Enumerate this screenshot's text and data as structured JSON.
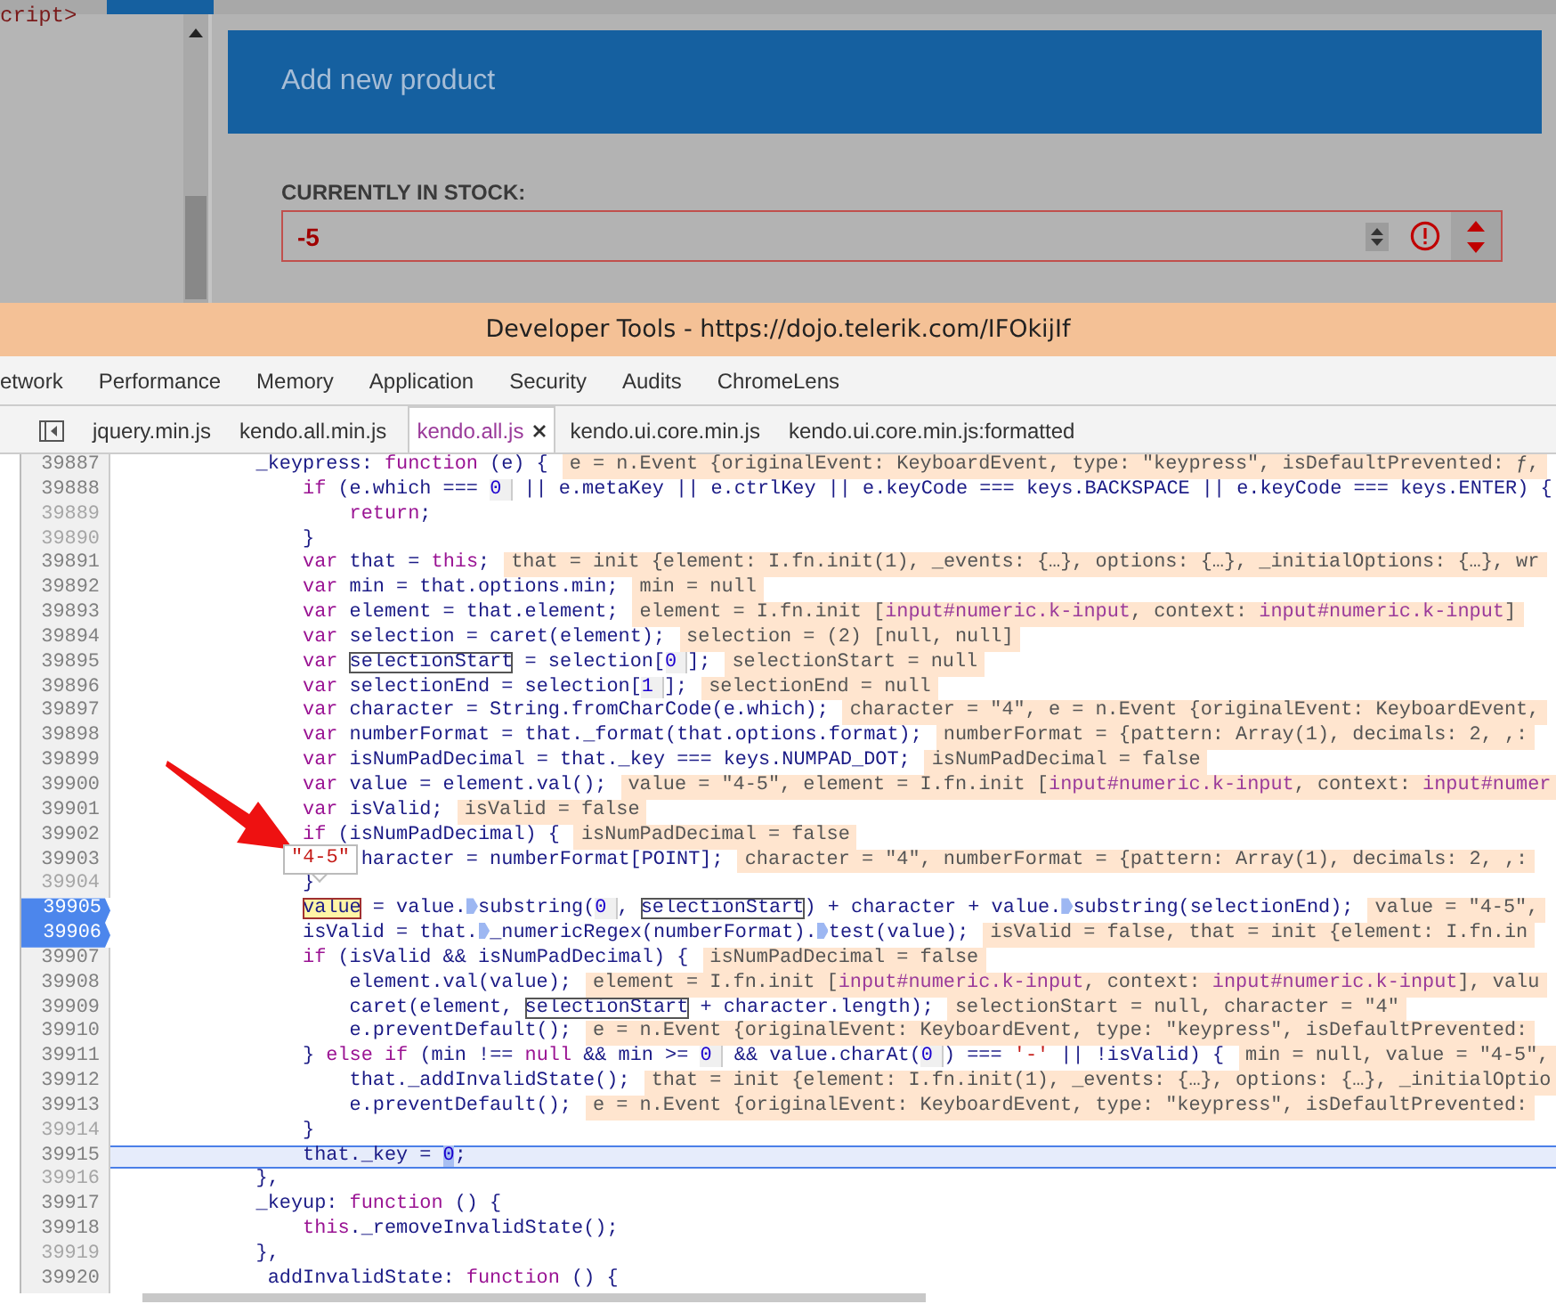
{
  "app": {
    "source_snippet": "cript>",
    "header": {
      "title": "Add new product"
    },
    "stock": {
      "label": "CURRENTLY IN STOCK:",
      "value": "-5",
      "invalid": true
    }
  },
  "devtools": {
    "title": "Developer Tools - https://dojo.telerik.com/IFOkijIf",
    "panels": [
      {
        "label": "etwork",
        "selected": false
      },
      {
        "label": "Performance",
        "selected": false
      },
      {
        "label": "Memory",
        "selected": false
      },
      {
        "label": "Application",
        "selected": false
      },
      {
        "label": "Security",
        "selected": false
      },
      {
        "label": "Audits",
        "selected": false
      },
      {
        "label": "ChromeLens",
        "selected": false
      }
    ],
    "files": [
      {
        "label": "jquery.min.js",
        "selected": false
      },
      {
        "label": "kendo.all.min.js",
        "selected": false
      },
      {
        "label": "kendo.all.js",
        "selected": true
      },
      {
        "label": "kendo.ui.core.min.js",
        "selected": false
      },
      {
        "label": "kendo.ui.core.min.js:formatted",
        "selected": false
      }
    ],
    "code": {
      "lines": [
        {
          "number": "39887",
          "dim": false,
          "breakpoint": false,
          "current": false,
          "code": [
            {
              "t": "            _keypress: "
            },
            {
              "t": "function",
              "kind": "kw"
            },
            {
              "t": " (e) {"
            }
          ],
          "hint": [
            {
              "t": "e = n.Event {originalEvent: KeyboardEvent, type: \"keypress\", isDefaultPrevented: ƒ,"
            }
          ]
        },
        {
          "number": "39888",
          "dim": false,
          "breakpoint": false,
          "current": false,
          "code": [
            {
              "t": "                if",
              "kind": "kw"
            },
            {
              "t": " (e.which === "
            },
            {
              "t": "0",
              "kind": "num"
            },
            {
              "t": " || e.metaKey || e.ctrlKey || e.keyCode === keys.BACKSPACE || e.keyCode === keys.ENTER) {"
            }
          ]
        },
        {
          "number": "39889",
          "dim": true,
          "breakpoint": false,
          "current": false,
          "code": [
            {
              "t": "                    return",
              "kind": "kw"
            },
            {
              "t": ";"
            }
          ]
        },
        {
          "number": "39890",
          "dim": true,
          "breakpoint": false,
          "current": false,
          "code": [
            {
              "t": "                }"
            }
          ]
        },
        {
          "number": "39891",
          "dim": false,
          "breakpoint": false,
          "current": false,
          "code": [
            {
              "t": "                var",
              "kind": "kw"
            },
            {
              "t": " that = "
            },
            {
              "t": "this",
              "kind": "kw"
            },
            {
              "t": ";"
            }
          ],
          "hint": [
            {
              "t": "that = init {element: I.fn.init(1), _events: {…}, options: {…}, _initialOptions: {…}, wr"
            }
          ]
        },
        {
          "number": "39892",
          "dim": false,
          "breakpoint": false,
          "current": false,
          "code": [
            {
              "t": "                var",
              "kind": "kw"
            },
            {
              "t": " min = that.options.min;"
            }
          ],
          "hint": [
            {
              "t": "min = null"
            }
          ]
        },
        {
          "number": "39893",
          "dim": false,
          "breakpoint": false,
          "current": false,
          "code": [
            {
              "t": "                var",
              "kind": "kw"
            },
            {
              "t": " element = that.element;"
            }
          ],
          "hint": [
            {
              "t": "element = I.fn.init ["
            },
            {
              "t": "input#numeric.k-input",
              "kind": "sel"
            },
            {
              "t": ", context: "
            },
            {
              "t": "input#numeric.k-input",
              "kind": "sel"
            },
            {
              "t": "]"
            }
          ]
        },
        {
          "number": "39894",
          "dim": false,
          "breakpoint": false,
          "current": false,
          "code": [
            {
              "t": "                var",
              "kind": "kw"
            },
            {
              "t": " selection = caret(element);"
            }
          ],
          "hint": [
            {
              "t": "selection = (2) [null, null]"
            }
          ]
        },
        {
          "number": "39895",
          "dim": false,
          "breakpoint": false,
          "current": false,
          "code": [
            {
              "t": "                var ",
              "kind": "kw"
            },
            {
              "t": "selectionStart",
              "kind": "box"
            },
            {
              "t": " = selection["
            },
            {
              "t": "0",
              "kind": "num"
            },
            {
              "t": "];"
            }
          ],
          "hint": [
            {
              "t": "selectionStart = null"
            }
          ]
        },
        {
          "number": "39896",
          "dim": false,
          "breakpoint": false,
          "current": false,
          "code": [
            {
              "t": "                var",
              "kind": "kw"
            },
            {
              "t": " selectionEnd = selection["
            },
            {
              "t": "1",
              "kind": "num"
            },
            {
              "t": "];"
            }
          ],
          "hint": [
            {
              "t": "selectionEnd = null"
            }
          ]
        },
        {
          "number": "39897",
          "dim": false,
          "breakpoint": false,
          "current": false,
          "code": [
            {
              "t": "                var",
              "kind": "kw"
            },
            {
              "t": " character = String.fromCharCode(e.which);"
            }
          ],
          "hint": [
            {
              "t": "character = \"4\", e = n.Event {originalEvent: KeyboardEvent,"
            }
          ]
        },
        {
          "number": "39898",
          "dim": false,
          "breakpoint": false,
          "current": false,
          "code": [
            {
              "t": "                var",
              "kind": "kw"
            },
            {
              "t": " numberFormat = that._format(that.options.format);"
            }
          ],
          "hint": [
            {
              "t": "numberFormat = {pattern: Array(1), decimals: 2, ,:"
            }
          ]
        },
        {
          "number": "39899",
          "dim": false,
          "breakpoint": false,
          "current": false,
          "code": [
            {
              "t": "                var",
              "kind": "kw"
            },
            {
              "t": " isNumPadDecimal = that._key === keys.NUMPAD_DOT;"
            }
          ],
          "hint": [
            {
              "t": "isNumPadDecimal = false"
            }
          ]
        },
        {
          "number": "39900",
          "dim": false,
          "breakpoint": false,
          "current": false,
          "code": [
            {
              "t": "                var",
              "kind": "kw"
            },
            {
              "t": " value = element.val();"
            }
          ],
          "hint": [
            {
              "t": "value = \"4-5\", element = I.fn.init ["
            },
            {
              "t": "input#numeric.k-input",
              "kind": "sel"
            },
            {
              "t": ", context: "
            },
            {
              "t": "input#numer",
              "kind": "sel"
            }
          ]
        },
        {
          "number": "39901",
          "dim": false,
          "breakpoint": false,
          "current": false,
          "code": [
            {
              "t": "                var",
              "kind": "kw"
            },
            {
              "t": " isValid;"
            }
          ],
          "hint": [
            {
              "t": "isValid = false"
            }
          ]
        },
        {
          "number": "39902",
          "dim": false,
          "breakpoint": false,
          "current": false,
          "code": [
            {
              "t": "                if",
              "kind": "kw"
            },
            {
              "t": " (isNumPadDecimal) {"
            }
          ],
          "hint": [
            {
              "t": "isNumPadDecimal = false"
            }
          ]
        },
        {
          "number": "39903",
          "dim": false,
          "breakpoint": false,
          "current": false,
          "code": [
            {
              "t": "                     haracter = numberFormat[POINT];"
            }
          ],
          "hint": [
            {
              "t": "character = \"4\", numberFormat = {pattern: Array(1), decimals: 2, ,:"
            }
          ]
        },
        {
          "number": "39904",
          "dim": true,
          "breakpoint": false,
          "current": false,
          "code": [
            {
              "t": "                }"
            }
          ]
        },
        {
          "number": "39905",
          "dim": false,
          "breakpoint": true,
          "current": false,
          "code": [
            {
              "t": "                value",
              "kind": "hl"
            },
            {
              "t": " = value."
            },
            {
              "kind": "step"
            },
            {
              "t": "substring("
            },
            {
              "t": "0",
              "kind": "num"
            },
            {
              "t": ", "
            },
            {
              "t": "selectionStart",
              "kind": "box"
            },
            {
              "t": ") + character + value."
            },
            {
              "kind": "step"
            },
            {
              "t": "substring(selectionEnd);"
            }
          ],
          "hint": [
            {
              "t": "value = \"4-5\","
            }
          ]
        },
        {
          "number": "39906",
          "dim": false,
          "breakpoint": true,
          "current": false,
          "code": [
            {
              "t": "                isValid = that."
            },
            {
              "kind": "step"
            },
            {
              "t": "_numericRegex(numberFormat)."
            },
            {
              "kind": "step"
            },
            {
              "t": "test(value);"
            }
          ],
          "hint": [
            {
              "t": "isValid = false, that = init {element: I.fn.in"
            }
          ]
        },
        {
          "number": "39907",
          "dim": false,
          "breakpoint": false,
          "current": false,
          "code": [
            {
              "t": "                if",
              "kind": "kw"
            },
            {
              "t": " (isValid && isNumPadDecimal) {"
            }
          ],
          "hint": [
            {
              "t": "isNumPadDecimal = false"
            }
          ]
        },
        {
          "number": "39908",
          "dim": false,
          "breakpoint": false,
          "current": false,
          "code": [
            {
              "t": "                    element.val(value);"
            }
          ],
          "hint": [
            {
              "t": "element = I.fn.init ["
            },
            {
              "t": "input#numeric.k-input",
              "kind": "sel"
            },
            {
              "t": ", context: "
            },
            {
              "t": "input#numeric.k-input",
              "kind": "sel"
            },
            {
              "t": "], valu"
            }
          ]
        },
        {
          "number": "39909",
          "dim": false,
          "breakpoint": false,
          "current": false,
          "code": [
            {
              "t": "                    caret(element, "
            },
            {
              "t": "selectionStart",
              "kind": "box"
            },
            {
              "t": " + character.length);"
            }
          ],
          "hint": [
            {
              "t": "selectionStart = null, character = \"4\""
            }
          ]
        },
        {
          "number": "39910",
          "dim": false,
          "breakpoint": false,
          "current": false,
          "code": [
            {
              "t": "                    e.preventDefault();"
            }
          ],
          "hint": [
            {
              "t": "e = n.Event {originalEvent: KeyboardEvent, type: \"keypress\", isDefaultPrevented:"
            }
          ]
        },
        {
          "number": "39911",
          "dim": false,
          "breakpoint": false,
          "current": false,
          "code": [
            {
              "t": "                } "
            },
            {
              "t": "else if",
              "kind": "kw"
            },
            {
              "t": " (min !== "
            },
            {
              "t": "null",
              "kind": "kw"
            },
            {
              "t": " && min >= "
            },
            {
              "t": "0",
              "kind": "num"
            },
            {
              "t": " && value.charAt("
            },
            {
              "t": "0",
              "kind": "num"
            },
            {
              "t": ") === "
            },
            {
              "t": "'-'",
              "kind": "str"
            },
            {
              "t": " || !isValid) {"
            }
          ],
          "hint": [
            {
              "t": "min = null, value = \"4-5\","
            }
          ]
        },
        {
          "number": "39912",
          "dim": false,
          "breakpoint": false,
          "current": false,
          "code": [
            {
              "t": "                    that._addInvalidState();"
            }
          ],
          "hint": [
            {
              "t": "that = init {element: I.fn.init(1), _events: {…}, options: {…}, _initialOptio"
            }
          ]
        },
        {
          "number": "39913",
          "dim": false,
          "breakpoint": false,
          "current": false,
          "code": [
            {
              "t": "                    e.preventDefault();"
            }
          ],
          "hint": [
            {
              "t": "e = n.Event {originalEvent: KeyboardEvent, type: \"keypress\", isDefaultPrevented:"
            }
          ]
        },
        {
          "number": "39914",
          "dim": true,
          "breakpoint": false,
          "current": false,
          "code": [
            {
              "t": "                }"
            }
          ]
        },
        {
          "number": "39915",
          "dim": false,
          "breakpoint": false,
          "current": true,
          "code": [
            {
              "t": "                that._key = "
            },
            {
              "t": "0",
              "kind": "cur"
            },
            {
              "t": ";"
            }
          ]
        },
        {
          "number": "39916",
          "dim": true,
          "breakpoint": false,
          "current": false,
          "code": [
            {
              "t": "            },"
            }
          ]
        },
        {
          "number": "39917",
          "dim": false,
          "breakpoint": false,
          "current": false,
          "code": [
            {
              "t": "            _keyup: "
            },
            {
              "t": "function",
              "kind": "kw"
            },
            {
              "t": " () {"
            }
          ]
        },
        {
          "number": "39918",
          "dim": false,
          "breakpoint": false,
          "current": false,
          "code": [
            {
              "t": "                this",
              "kind": "kw"
            },
            {
              "t": "._removeInvalidState();"
            }
          ]
        },
        {
          "number": "39919",
          "dim": true,
          "breakpoint": false,
          "current": false,
          "code": [
            {
              "t": "            },"
            }
          ]
        },
        {
          "number": "39920",
          "dim": false,
          "breakpoint": false,
          "current": false,
          "code": [
            {
              "t": "             addInvalidState: "
            },
            {
              "t": "function",
              "kind": "kw"
            },
            {
              "t": " () {"
            }
          ]
        }
      ]
    },
    "tooltip": {
      "text": "\"4-5\""
    }
  }
}
